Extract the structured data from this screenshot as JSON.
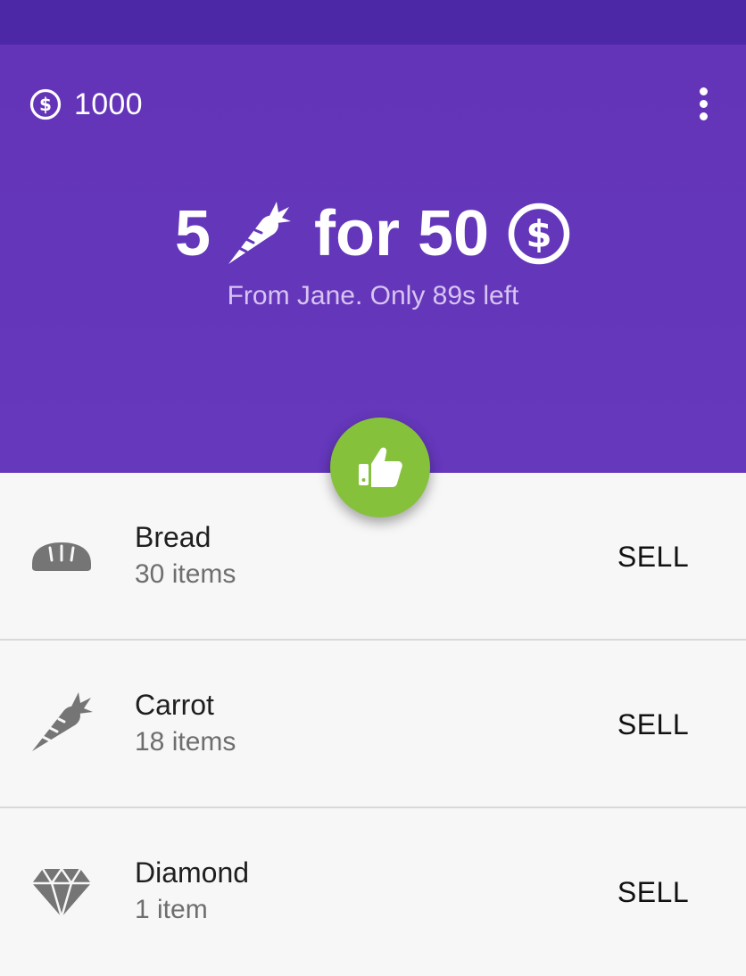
{
  "balance": {
    "amount": "1000",
    "icon": "coin-icon"
  },
  "menu": {
    "icon": "more-vert-icon"
  },
  "offer": {
    "quantity": "5",
    "item_icon": "carrot-icon",
    "word": "for",
    "price": "50",
    "currency_icon": "coin-icon",
    "subtitle": "From Jane. Only 89s left"
  },
  "accept": {
    "icon": "thumbs-up-icon",
    "color": "#86c13c"
  },
  "colors": {
    "status_bar": "#4c27a6",
    "header": "#6538bc",
    "subtitle": "#d8c4f2"
  },
  "inventory": [
    {
      "icon": "bread-icon",
      "name": "Bread",
      "count": "30 items",
      "action": "SELL"
    },
    {
      "icon": "carrot-icon",
      "name": "Carrot",
      "count": "18 items",
      "action": "SELL"
    },
    {
      "icon": "diamond-icon",
      "name": "Diamond",
      "count": "1 item",
      "action": "SELL"
    }
  ]
}
